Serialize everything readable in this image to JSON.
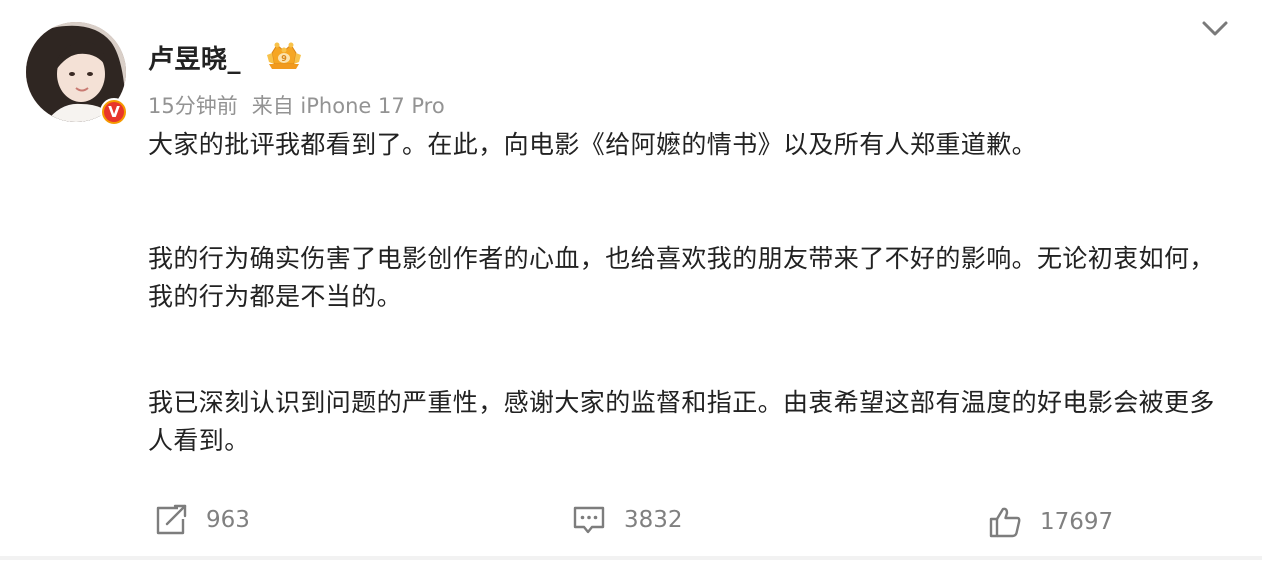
{
  "user": {
    "name": "卢昱晓_",
    "verified_badge": "V",
    "badge_icon": "crown-badge-icon"
  },
  "meta": {
    "time": "15分钟前",
    "source": "来自 iPhone 17 Pro"
  },
  "post": {
    "paragraphs": [
      "大家的批评我都看到了。在此，向电影《给阿嬷的情书》以及所有人郑重道歉。",
      "我的行为确实伤害了电影创作者的心血，也给喜欢我的朋友带来了不好的影响。无论初衷如何，我的行为都是不当的。",
      "我已深刻认识到问题的严重性，感谢大家的监督和指正。由衷希望这部有温度的好电影会被更多人看到。"
    ]
  },
  "actions": {
    "repost_count": "963",
    "comment_count": "3832",
    "like_count": "17697"
  },
  "colors": {
    "text": "#222222",
    "meta": "#939393",
    "action": "#808080",
    "badge_orange": "#f59a00",
    "badge_red": "#e8352b"
  }
}
